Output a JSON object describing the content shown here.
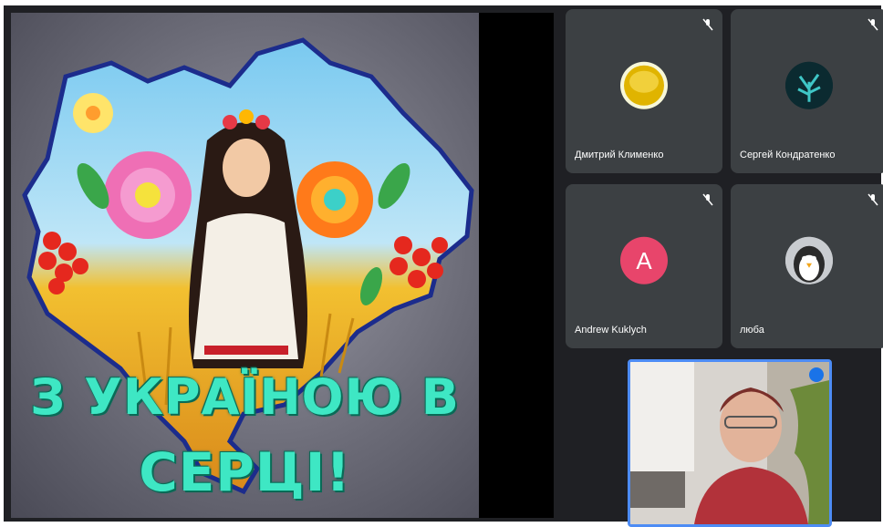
{
  "presentation": {
    "title_line1": "З УКРАЇНОЮ В",
    "title_line2": "СЕРЦІ!"
  },
  "participants": [
    {
      "name": "Дмитрий Клименко",
      "avatar_type": "image",
      "avatar_icon": "yellow-disc-photo",
      "muted": true
    },
    {
      "name": "Сергей Кондратенко",
      "avatar_type": "image",
      "avatar_icon": "teal-plant-photo",
      "muted": true
    },
    {
      "name": "Andrew Kuklych",
      "avatar_type": "letter",
      "avatar_letter": "A",
      "avatar_color": "#e8456b",
      "muted": true
    },
    {
      "name": "люба",
      "avatar_type": "image",
      "avatar_icon": "penguin-photo",
      "muted": true
    }
  ],
  "self_view": {
    "active_speaker": true,
    "border_color": "#4d8cf5"
  },
  "colors": {
    "tile_bg": "#3c4043",
    "title_text": "#3ee7c4",
    "map_outline": "#1c2c8c"
  }
}
